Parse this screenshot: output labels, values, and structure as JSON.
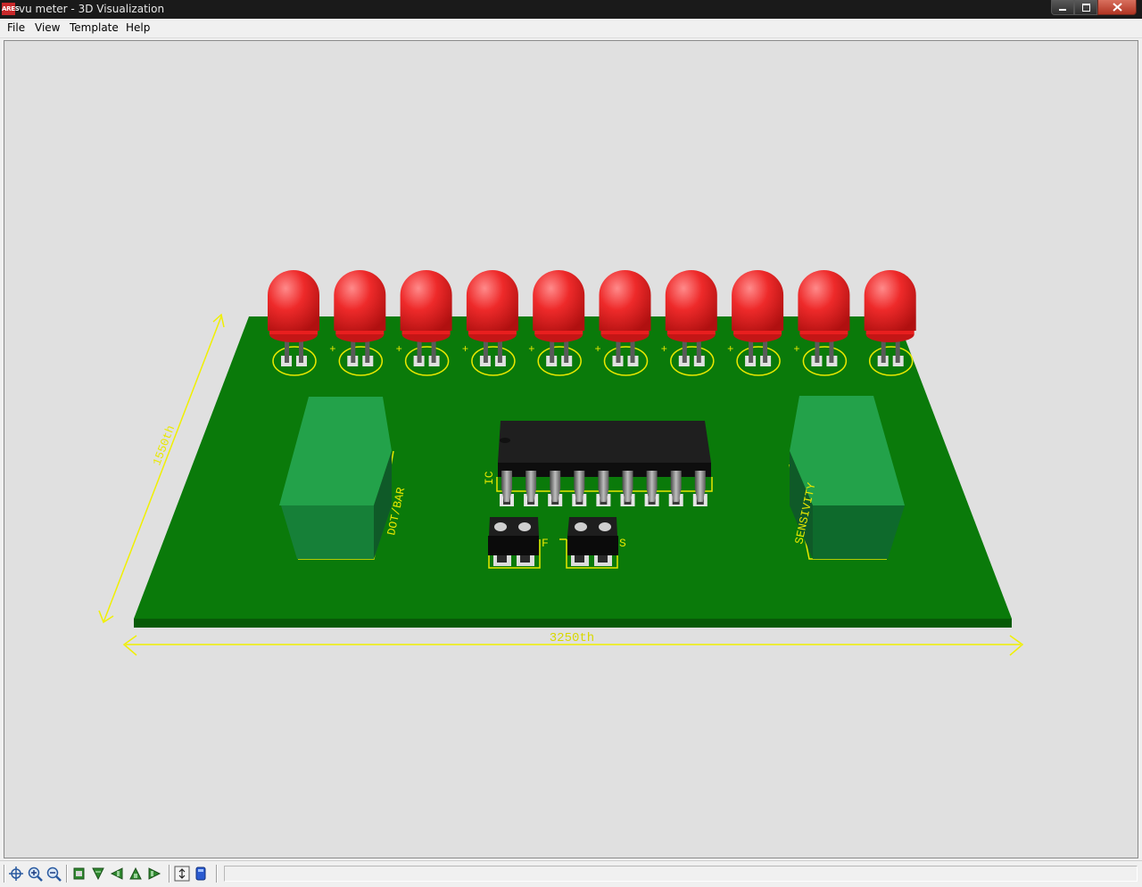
{
  "window": {
    "title": "vu meter - 3D Visualization",
    "app_icon_text": "ARES",
    "minimize_icon": "minimize-icon",
    "maximize_icon": "restore-icon",
    "close_icon": "close-icon"
  },
  "menu": {
    "items": [
      {
        "label": "File"
      },
      {
        "label": "View"
      },
      {
        "label": "Template"
      },
      {
        "label": "Help"
      }
    ]
  },
  "board": {
    "pcb_color": "#0b7a0b",
    "silkscreen_color": "#e8e800",
    "led_color": "#e81e1e",
    "led_count": 10,
    "labels": {
      "dot_bar": "DOT/BAR",
      "sensivity": "SENSIVITY",
      "ic": "IC",
      "dim_height": "1550th",
      "dim_width": "3250th",
      "led_plus": "+",
      "connector_left_label": "F",
      "connector_right_label": "S"
    }
  },
  "toolbar": {
    "buttons": [
      {
        "icon": "pan-icon"
      },
      {
        "icon": "zoom-in-icon"
      },
      {
        "icon": "zoom-out-icon"
      },
      {
        "icon": "view-front-icon"
      },
      {
        "icon": "view-top-icon"
      },
      {
        "icon": "view-left-icon"
      },
      {
        "icon": "view-back-icon"
      },
      {
        "icon": "view-right-icon"
      },
      {
        "icon": "dimensions-icon"
      },
      {
        "icon": "components-icon"
      }
    ]
  }
}
